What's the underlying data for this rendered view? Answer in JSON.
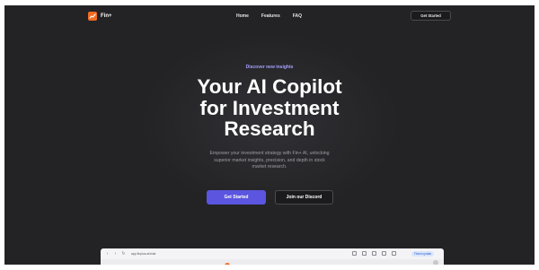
{
  "brand": {
    "name": "Fin+",
    "accent": "#f26b21"
  },
  "nav": {
    "links": [
      "Home",
      "Features",
      "FAQ"
    ],
    "cta_label": "Get Started"
  },
  "hero": {
    "eyebrow": "Discover new insights",
    "title_line1": "Your AI Copilot",
    "title_line2": "for Investment",
    "title_line3": "Research",
    "subtitle_line1": "Empower your investment strategy with Fin+ AI, unlocking",
    "subtitle_line2": "superior market insights, precision, and depth in stock",
    "subtitle_line3": "market research.",
    "primary_button": "Get Started",
    "secondary_button": "Join our Discord",
    "primary_color": "#5b55e0"
  },
  "browser_preview": {
    "url": "app.finplus.ai/chat",
    "badge": "Finish update"
  }
}
